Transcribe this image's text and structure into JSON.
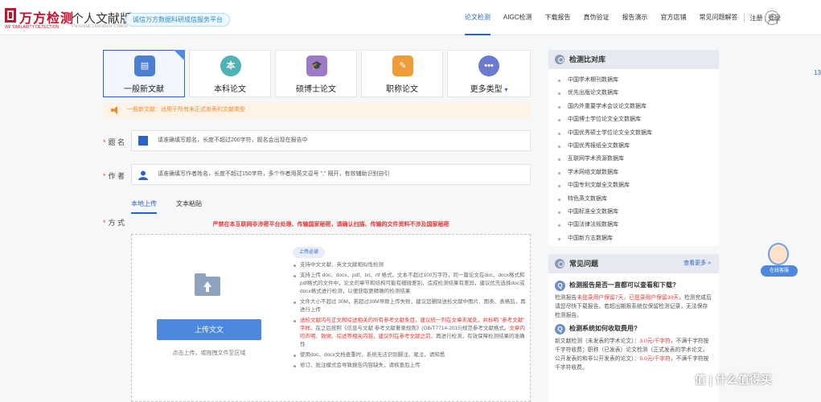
{
  "header": {
    "brand": "万方检测",
    "brand_sub": "WF SIMILARITY DETECTION",
    "product": "个人文献版",
    "product_sub": "Personal Literature Check",
    "slogan": "诚信万方数据科研成信服务平台",
    "nav": [
      "论文检测",
      "AIGC检测",
      "下载报告",
      "真伪验证",
      "报告演示",
      "官方店铺",
      "常见问题解答"
    ],
    "active_nav": 0,
    "auth": "注册 | 登录",
    "accent": "#2d63c8"
  },
  "types": [
    {
      "label": "一般新文献",
      "icon": "document-icon",
      "color": "#4b7fd6",
      "active": true
    },
    {
      "label": "本科论文",
      "icon": "badge-icon",
      "color": "#4fb3b3",
      "active": false
    },
    {
      "label": "硕博士论文",
      "icon": "graduation-cap-icon",
      "color": "#9b7bc8",
      "active": false
    },
    {
      "label": "职称论文",
      "icon": "certificate-icon",
      "color": "#f09b3a",
      "active": false
    },
    {
      "label": "更多类型",
      "icon": "more-icon",
      "color": "#6a7bd0",
      "active": false,
      "caret": "▾"
    }
  ],
  "notice": "一般新文献：适用于所有未正式发表的文献类型",
  "form": {
    "title_label": "题 名",
    "title_placeholder": "请准确填写题名，长度不超过200字符，题名会出现在报告中",
    "author_label": "作 者",
    "author_placeholder": "请准确填写作者姓名，长度不超过150字符，多个作者用英文逗号 \",\" 隔开，有效辅助识别自引",
    "method_label": "方 式",
    "required_mark": "*"
  },
  "upload": {
    "tabs": [
      "本地上传",
      "文本粘贴"
    ],
    "active_tab": 0,
    "warning": "严禁在本互联网非涉密平台处理、传输国家秘密，请确认扫描、传输的文件资料不涉及国家秘密",
    "button": "上传文文",
    "hint": "点击上传，或拖拽文件至区域",
    "rules_badge": "上传必读",
    "rules": [
      {
        "text": "支持中文文献、英文文献相似性检测"
      },
      {
        "text": "支持上传 doc、docx、pdf、txt、rtf 格式，文本不超过100万字符，同一篇论文在doc、docx格式和pdf格式的文件中，论文的章节和结构可能有细微差别，造成检测结果有差异，建议优先选择doc或docx格式进行检测，以便获取更精确的检测结果"
      },
      {
        "text": "文件大小不超过 30M，若超过30M导致上传失败，建议您删除送检文献中图片、图表、表格后，再进行上传"
      },
      {
        "red": "送检文献内与正文和综述相关的所有参考文献条目，建议统一列在文章末尾处，并标明 \"参考文献\" 字样。",
        "text": "在之后按照《信息与文献 参考文献著录规则》(GB/T7714-2015)规范参考文献格式。",
        "red2": "文章内的声明、致谢、综述等相关内容，建议列在参考文献之前，",
        "text2": "再进行检测，有效保障检测结果的准确性"
      },
      {
        "text": "使用doc、docx文档查重时，系统无法识别脚注、尾注，请知悉"
      },
      {
        "text": "修订、批注模式会导致报告内容缺失，请核查后上传"
      }
    ]
  },
  "sidebar": {
    "db_title": "检测比对库",
    "databases": [
      "中国学术期刊数据库",
      "优先出版论文数据库",
      "国内外重要学术会议论文数据库",
      "中国博士学位论文全文数据库",
      "中国优秀硕士学位论文全文数据库",
      "中国优秀报纸全文数据库",
      "互联网学术资源数据库",
      "学术网络文献数据库",
      "中国专利文献全文数据库",
      "特色英文数据库",
      "中国标准全文数据库",
      "中国法律法规数据库",
      "中国新方志数据库"
    ],
    "faq_title": "常见问题",
    "faq_more": "查看更多 »",
    "faq": [
      {
        "q": "检测报告是否一直都可以查看和下载?",
        "a1": "检测报告",
        "a_red": "未登录用户保留7天，已登录用户保留30天",
        "a2": "，检测完成后请您尽快下载报告。若超出期限系统仅保留检测记录，无法保存检测报告。"
      },
      {
        "q": "检测系统如何收取费用?",
        "a1": "新文献检测（未发表的学术论文）：",
        "a_red": "3.0元/千字符",
        "a2": "，不满千字符按千字符收费；职称（已发表）论文检测（正式发表的学术论文，公开发表的和非公开发表的论文）：",
        "a_red2": "5.0元/千字符",
        "a3": "，不满千字符按千字符收费。"
      }
    ]
  },
  "service": {
    "label": "在线客服"
  },
  "edge_text": "13",
  "watermark": "值 | 什么值得买"
}
